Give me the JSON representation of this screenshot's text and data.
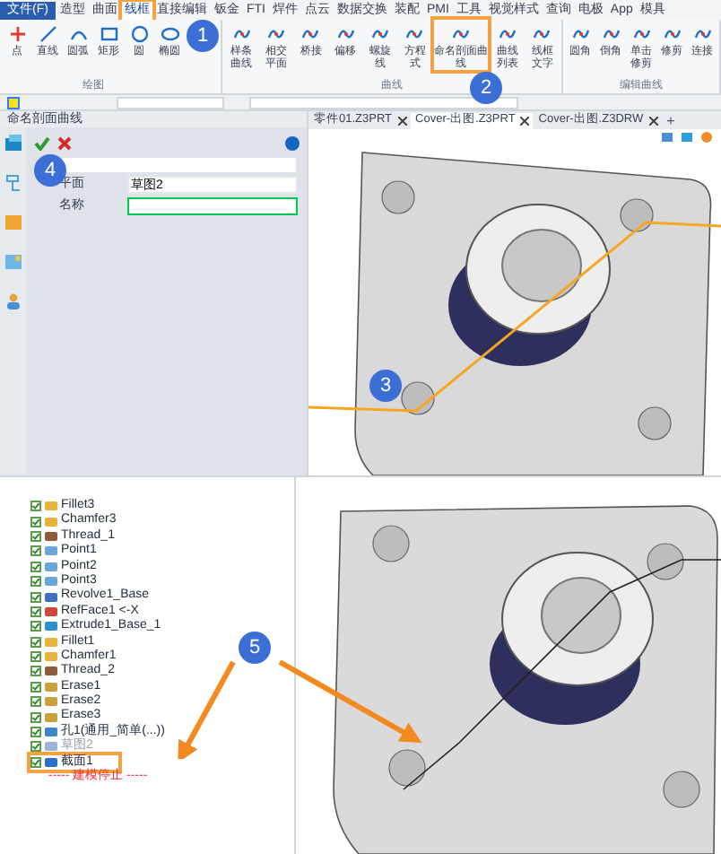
{
  "menu_tabs": [
    {
      "label": "文件(F)",
      "kind": "file",
      "selected": false,
      "boxed": false
    },
    {
      "label": "造型",
      "kind": "tab",
      "selected": false,
      "boxed": false
    },
    {
      "label": "曲面",
      "kind": "tab",
      "selected": false,
      "boxed": false
    },
    {
      "label": "线框",
      "kind": "tab",
      "selected": true,
      "boxed": true
    },
    {
      "label": "直接编辑",
      "kind": "tab",
      "selected": false,
      "boxed": false
    },
    {
      "label": "钣金",
      "kind": "tab",
      "selected": false,
      "boxed": false
    },
    {
      "label": "FTI",
      "kind": "tab",
      "selected": false,
      "boxed": false
    },
    {
      "label": "焊件",
      "kind": "tab",
      "selected": false,
      "boxed": false
    },
    {
      "label": "点云",
      "kind": "tab",
      "selected": false,
      "boxed": false
    },
    {
      "label": "数据交换",
      "kind": "tab",
      "selected": false,
      "boxed": false
    },
    {
      "label": "装配",
      "kind": "tab",
      "selected": false,
      "boxed": false
    },
    {
      "label": "PMI",
      "kind": "tab",
      "selected": false,
      "boxed": false
    },
    {
      "label": "工具",
      "kind": "tab",
      "selected": false,
      "boxed": false
    },
    {
      "label": "视觉样式",
      "kind": "tab",
      "selected": false,
      "boxed": false
    },
    {
      "label": "查询",
      "kind": "tab",
      "selected": false,
      "boxed": false
    },
    {
      "label": "电极",
      "kind": "tab",
      "selected": false,
      "boxed": false
    },
    {
      "label": "App",
      "kind": "tab",
      "selected": false,
      "boxed": false
    },
    {
      "label": "模具",
      "kind": "tab",
      "selected": false,
      "boxed": false
    }
  ],
  "ribbon_groups": [
    {
      "label": "绘图",
      "tools": [
        {
          "label": "点",
          "boxed": false
        },
        {
          "label": "直线",
          "boxed": false
        },
        {
          "label": "圆弧",
          "boxed": false
        },
        {
          "label": "矩形",
          "boxed": false
        },
        {
          "label": "圆",
          "boxed": false
        },
        {
          "label": "椭圆",
          "boxed": false
        }
      ]
    },
    {
      "label": "曲线",
      "tools": [
        {
          "label": "样条曲线",
          "boxed": false
        },
        {
          "label": "相交平面",
          "boxed": false
        },
        {
          "label": "桥接",
          "boxed": false
        },
        {
          "label": "偏移",
          "boxed": false
        },
        {
          "label": "螺旋线",
          "boxed": false
        },
        {
          "label": "方程式",
          "boxed": false
        },
        {
          "label": "命名剖面曲线",
          "boxed": true
        },
        {
          "label": "曲线列表",
          "boxed": false
        },
        {
          "label": "线框文字",
          "boxed": false
        }
      ]
    },
    {
      "label": "编辑曲线",
      "tools": [
        {
          "label": "圆角",
          "boxed": false
        },
        {
          "label": "倒角",
          "boxed": false
        },
        {
          "label": "单击修剪",
          "boxed": false
        },
        {
          "label": "修剪",
          "boxed": false
        },
        {
          "label": "连接",
          "boxed": false
        }
      ]
    }
  ],
  "panel": {
    "title": "命名剖面曲线",
    "fields": [
      {
        "label": "平面",
        "value": "草图2",
        "focused": false
      },
      {
        "label": "名称",
        "focused": true
      }
    ]
  },
  "document_tabs": [
    {
      "label": "零件01.Z3PRT",
      "selected": false
    },
    {
      "label": "Cover-出图.Z3PRT",
      "selected": true
    },
    {
      "label": "Cover-出图.Z3DRW",
      "selected": false
    }
  ],
  "new_tab": "+",
  "history_tree": [
    {
      "label": "Fillet3",
      "kind": "fillet",
      "disabled": false,
      "boxed": false
    },
    {
      "label": "Chamfer3",
      "kind": "fillet",
      "disabled": false,
      "boxed": false
    },
    {
      "label": "Thread_1",
      "kind": "thread",
      "disabled": false,
      "boxed": false
    },
    {
      "label": "Point1",
      "kind": "point",
      "disabled": false,
      "boxed": false
    },
    {
      "label": "Point2",
      "kind": "point",
      "disabled": false,
      "boxed": false
    },
    {
      "label": "Point3",
      "kind": "point",
      "disabled": false,
      "boxed": false
    },
    {
      "label": "Revolve1_Base",
      "kind": "revolve",
      "disabled": false,
      "boxed": false
    },
    {
      "label": "RefFace1 <-X",
      "kind": "face",
      "disabled": false,
      "boxed": false
    },
    {
      "label": "Extrude1_Base_1",
      "kind": "extrude",
      "disabled": false,
      "boxed": false
    },
    {
      "label": "Fillet1",
      "kind": "fillet",
      "disabled": false,
      "boxed": false
    },
    {
      "label": "Chamfer1",
      "kind": "fillet",
      "disabled": false,
      "boxed": false
    },
    {
      "label": "Thread_2",
      "kind": "thread",
      "disabled": false,
      "boxed": false
    },
    {
      "label": "Erase1",
      "kind": "erase",
      "disabled": false,
      "boxed": false
    },
    {
      "label": "Erase2",
      "kind": "erase",
      "disabled": false,
      "boxed": false
    },
    {
      "label": "Erase3",
      "kind": "erase",
      "disabled": false,
      "boxed": false
    },
    {
      "label": "孔1(通用_简单(...))",
      "kind": "hole",
      "disabled": false,
      "boxed": false
    },
    {
      "label": "草图2",
      "kind": "sketch",
      "disabled": true,
      "boxed": false
    },
    {
      "label": "截面1",
      "kind": "section",
      "disabled": false,
      "boxed": true
    }
  ],
  "stop_marker": "----- 建模停止 -----",
  "step_markers": [
    "1",
    "2",
    "3",
    "4",
    "5"
  ]
}
